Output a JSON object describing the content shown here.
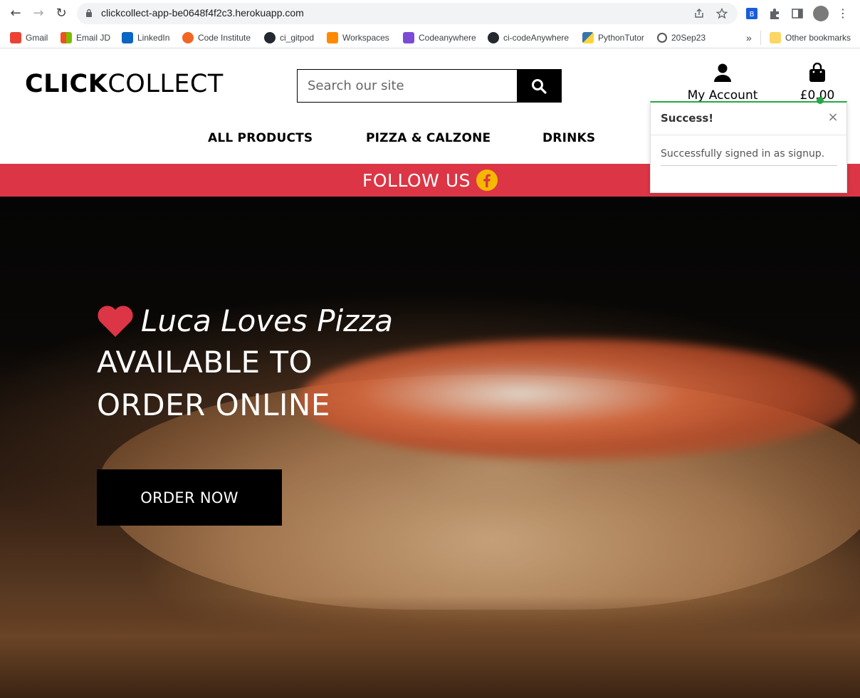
{
  "browser": {
    "url": "clickcollect-app-be0648f4f2c3.herokuapp.com",
    "bookmarks": [
      {
        "label": "Gmail",
        "icon": "gmail-icon",
        "color": "#ea4335"
      },
      {
        "label": "Email JD",
        "icon": "microsoft-icon",
        "color": "#f25022"
      },
      {
        "label": "LinkedIn",
        "icon": "linkedin-icon",
        "color": "#0a66c2"
      },
      {
        "label": "Code Institute",
        "icon": "code-institute-icon",
        "color": "#f26522"
      },
      {
        "label": "ci_gitpod",
        "icon": "github-icon",
        "color": "#24292f"
      },
      {
        "label": "Workspaces",
        "icon": "gitpod-icon",
        "color": "#ff8a00"
      },
      {
        "label": "Codeanywhere",
        "icon": "codeanywhere-icon",
        "color": "#7b4bd6"
      },
      {
        "label": "ci-codeAnywhere",
        "icon": "github-icon",
        "color": "#24292f"
      },
      {
        "label": "PythonTutor",
        "icon": "python-icon",
        "color": "#3776ab"
      },
      {
        "label": "20Sep23",
        "icon": "sync-icon",
        "color": "#555555"
      }
    ],
    "overflow_label": "»",
    "other_bookmarks": "Other bookmarks"
  },
  "site": {
    "logo_bold": "CLICK",
    "logo_light": "COLLECT",
    "search_placeholder": "Search our site",
    "account_label": "My Account",
    "bag_total": "£0.00",
    "nav": [
      "ALL PRODUCTS",
      "PIZZA & CALZONE",
      "DRINKS"
    ],
    "follow_text": "FOLLOW US",
    "accent_red": "#dc3545",
    "accent_yellow": "#f5b800"
  },
  "hero": {
    "tagline": "Luca Loves Pizza",
    "line1": "AVAILABLE TO",
    "line2": "ORDER ONLINE",
    "cta": "ORDER NOW"
  },
  "toast": {
    "title": "Success!",
    "close": "×",
    "message": "Successfully signed in as signup.",
    "accent": "#28a745"
  }
}
